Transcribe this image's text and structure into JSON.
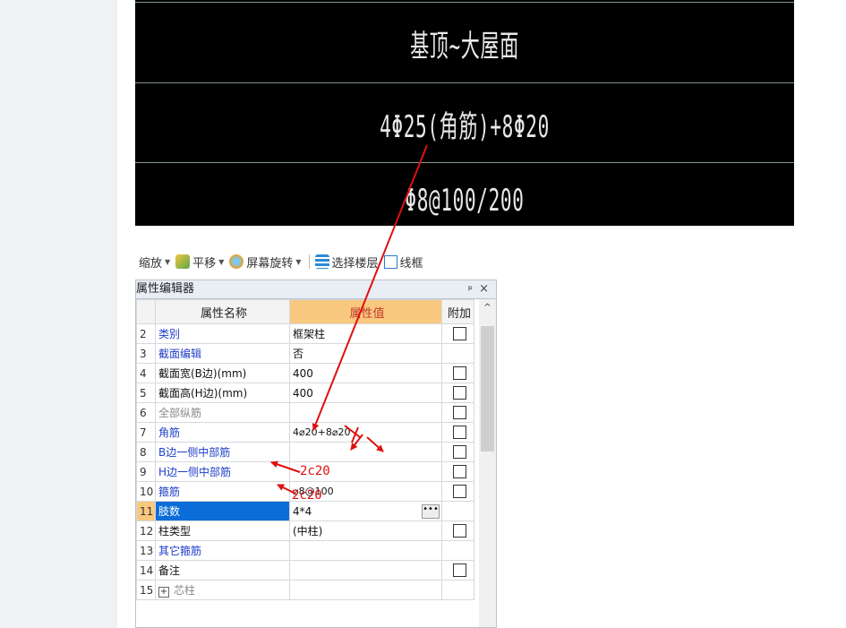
{
  "cad": {
    "line1": "基顶~大屋面",
    "line2": "4Φ25(角筋)+8Φ20",
    "line3": "Φ8@100/200"
  },
  "toolbar": {
    "zoom": "缩放",
    "pan": "平移",
    "rotate": "屏幕旋转",
    "select_floor": "选择楼层",
    "wireframe": "线框"
  },
  "panel": {
    "title": "属性编辑器",
    "pin": "ᵖ",
    "close": "×",
    "col_name": "属性名称",
    "col_value": "属性值",
    "col_extra": "附加"
  },
  "rows": [
    {
      "idx": "2",
      "name": "类别",
      "value": "框架柱"
    },
    {
      "idx": "3",
      "name": "截面编辑",
      "value": "否"
    },
    {
      "idx": "4",
      "name": "截面宽(B边)(mm)",
      "value": "400"
    },
    {
      "idx": "5",
      "name": "截面高(H边)(mm)",
      "value": "400"
    },
    {
      "idx": "6",
      "name": "全部纵筋",
      "value": ""
    },
    {
      "idx": "7",
      "name": "角筋",
      "value": "4⌀20+8⌀20"
    },
    {
      "idx": "8",
      "name": "B边一侧中部筋",
      "value": ""
    },
    {
      "idx": "9",
      "name": "H边一侧中部筋",
      "value": ""
    },
    {
      "idx": "10",
      "name": "箍筋",
      "value": "⌀8@100"
    },
    {
      "idx": "11",
      "name": "肢数",
      "value": "4*4"
    },
    {
      "idx": "12",
      "name": "柱类型",
      "value": "(中柱)"
    },
    {
      "idx": "13",
      "name": "其它箍筋",
      "value": ""
    },
    {
      "idx": "14",
      "name": "备注",
      "value": ""
    },
    {
      "idx": "15",
      "name": "芯柱",
      "value": ""
    }
  ],
  "annotations": {
    "b_side": "2c20",
    "h_side": "2c20"
  },
  "colors": {
    "annotation": "#e01010",
    "header_value_bg": "#f9c87f",
    "selection": "#0a6dd8",
    "link_text": "#1f3fc8"
  }
}
